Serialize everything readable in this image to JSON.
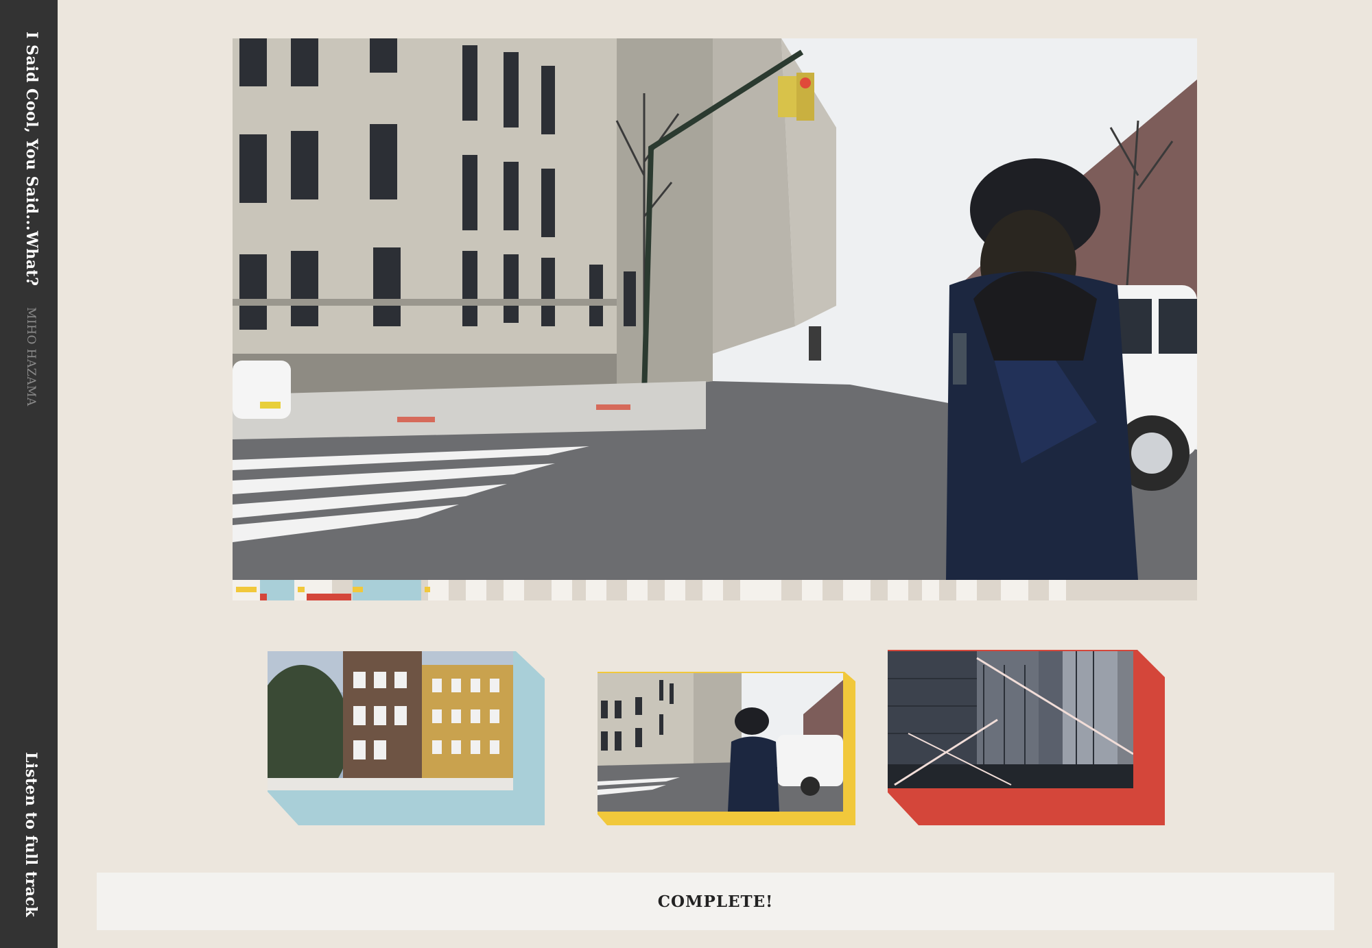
{
  "sidebar": {
    "song_title": "I Said Cool, You Said...What?",
    "artist": "MIHO HAZAMA",
    "full_track_link": "Listen to full track"
  },
  "main_video": {
    "icon": "street-scene-photo"
  },
  "progress": {
    "colors": {
      "yellow": "#f1c83b",
      "blue": "#a9cfd8",
      "red": "#d4463a",
      "light": "#f4f1ec",
      "mid": "#ddd6cc"
    }
  },
  "thumbnails": [
    {
      "name": "buildings-thumb",
      "accent": "#a9cfd8"
    },
    {
      "name": "street-thumb",
      "accent": "#f1c83b"
    },
    {
      "name": "skyscraper-thumb",
      "accent": "#d4463a"
    }
  ],
  "status": {
    "complete_label": "COMPLETE!"
  }
}
